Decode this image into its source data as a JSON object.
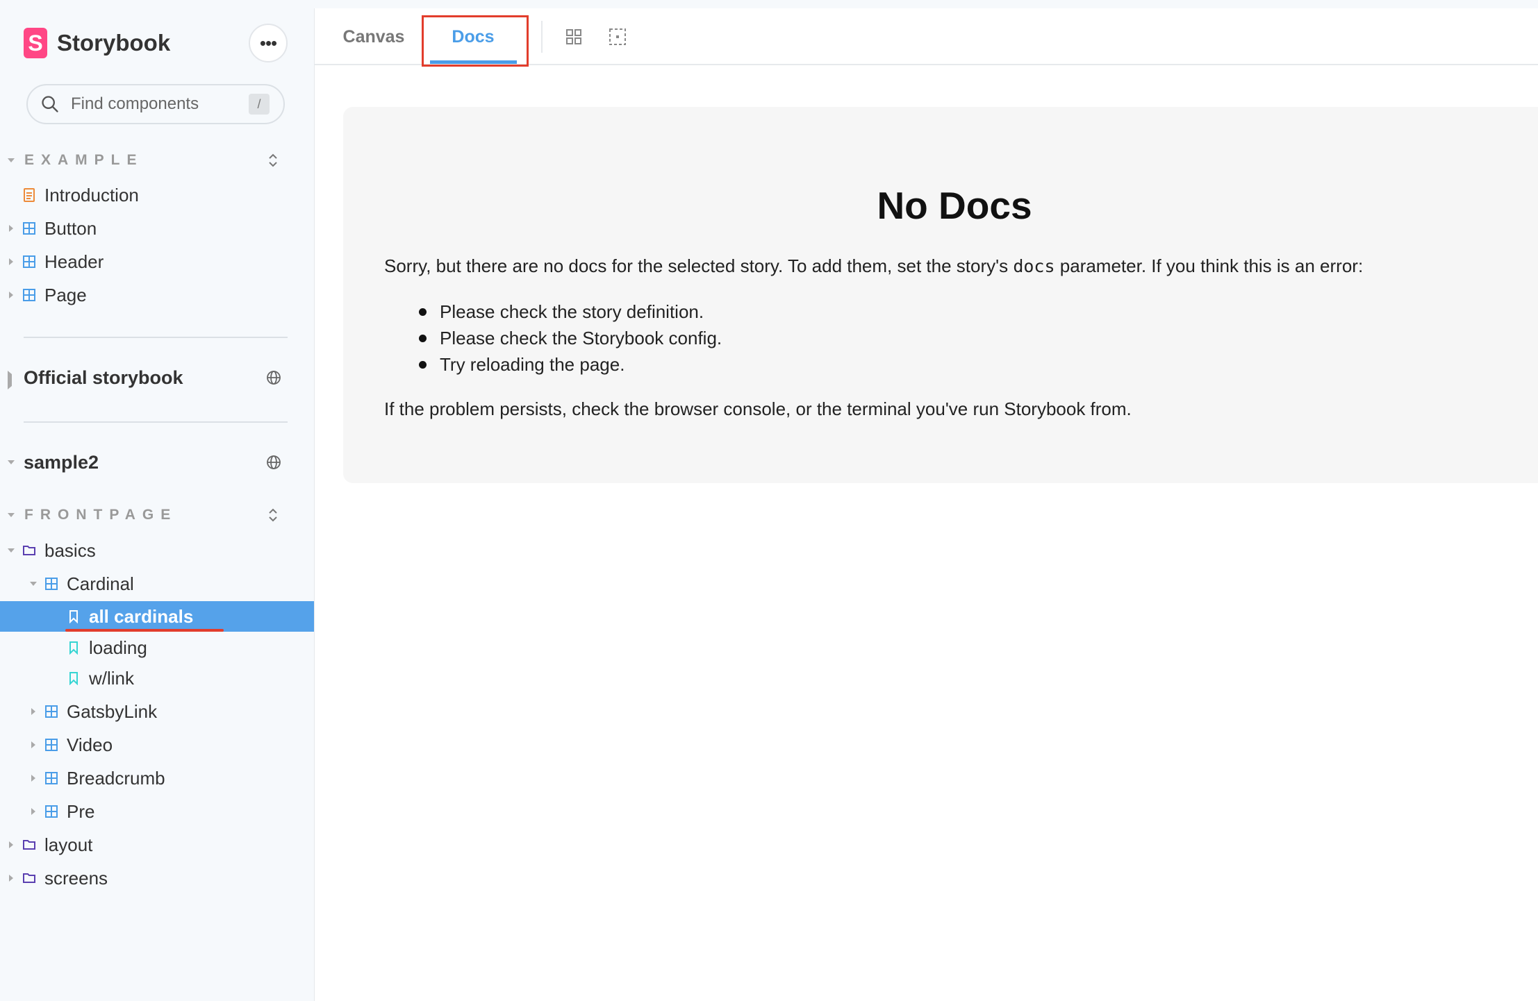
{
  "brand": {
    "name": "Storybook",
    "logo_letter": "S",
    "logo_color": "#ff4785"
  },
  "menu": {
    "label": "•••"
  },
  "search": {
    "placeholder": "Find components",
    "shortcut": "/"
  },
  "sidebar": {
    "sections": [
      {
        "title": "EXAMPLE"
      },
      {
        "title": "FRONTPAGE"
      }
    ],
    "example_items": [
      {
        "label": "Introduction",
        "icon": "document-icon"
      },
      {
        "label": "Button",
        "icon": "component-icon"
      },
      {
        "label": "Header",
        "icon": "component-icon"
      },
      {
        "label": "Page",
        "icon": "component-icon"
      }
    ],
    "refs": [
      {
        "title": "Official storybook"
      },
      {
        "title": "sample2"
      }
    ],
    "frontpage_items": [
      {
        "label": "basics",
        "icon": "folder-icon"
      },
      {
        "label": "Cardinal",
        "icon": "component-icon"
      },
      {
        "label": "all cardinals",
        "icon": "bookmark-icon",
        "selected": true
      },
      {
        "label": "loading",
        "icon": "bookmark-icon"
      },
      {
        "label": "w/link",
        "icon": "bookmark-icon"
      },
      {
        "label": "GatsbyLink",
        "icon": "component-icon"
      },
      {
        "label": "Video",
        "icon": "component-icon"
      },
      {
        "label": "Breadcrumb",
        "icon": "component-icon"
      },
      {
        "label": "Pre",
        "icon": "component-icon"
      },
      {
        "label": "layout",
        "icon": "folder-icon"
      },
      {
        "label": "screens",
        "icon": "folder-icon"
      }
    ]
  },
  "toolbar": {
    "tabs": [
      {
        "label": "Canvas"
      },
      {
        "label": "Docs",
        "active": true
      }
    ],
    "accent": "#4a9de8"
  },
  "docs": {
    "title": "No Docs",
    "intro_before": "Sorry, but there are no docs for the selected story. To add them, set the story's ",
    "intro_code": "docs",
    "intro_after": " parameter. If you think this is an error:",
    "bullets": [
      "Please check the story definition.",
      "Please check the Storybook config.",
      "Try reloading the page."
    ],
    "footer": "If the problem persists, check the browser console, or the terminal you've run Storybook from."
  }
}
